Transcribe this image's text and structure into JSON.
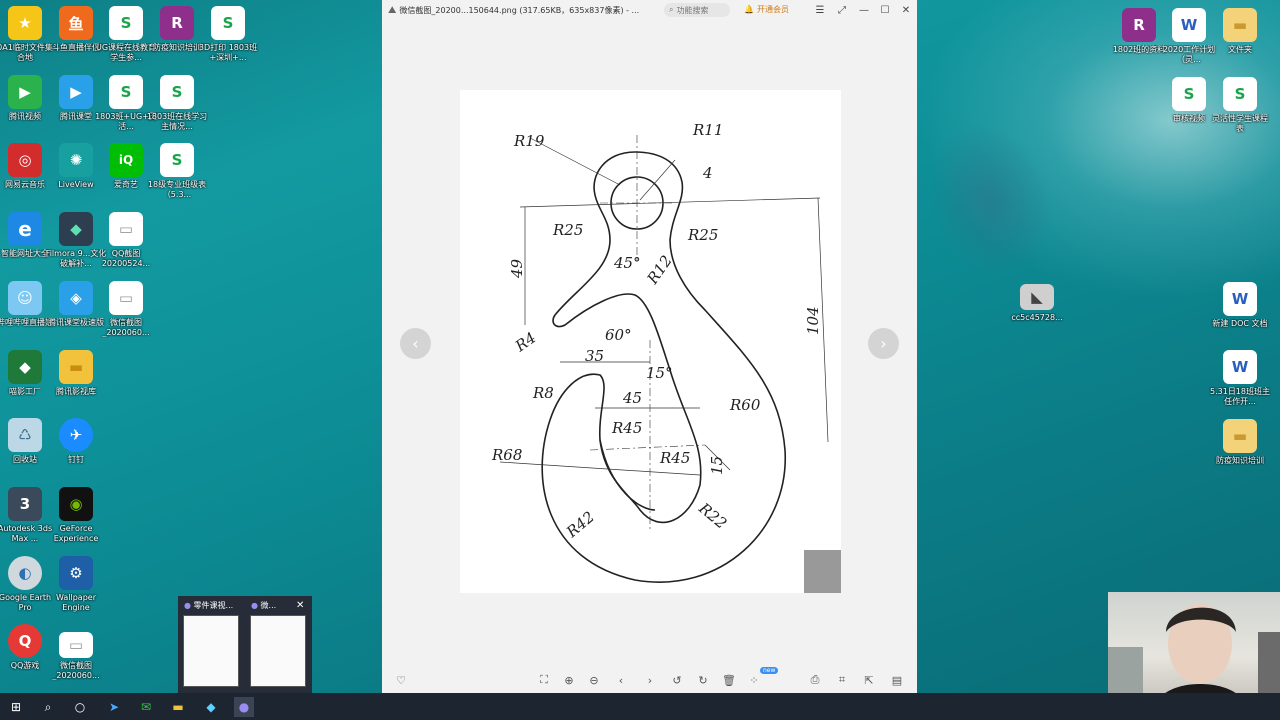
{
  "desktop_left": [
    {
      "label": "0A1临时文件集合地",
      "icon": "star-folder-icon",
      "color": "#f5c518",
      "glyph": "★"
    },
    {
      "label": "斗鱼直播伴侣",
      "icon": "douyu-icon",
      "color": "#f06a1d",
      "glyph": "鱼"
    },
    {
      "label": "UG课程在线教育学生参...",
      "icon": "sheet-doc-icon",
      "color": "#ffffff",
      "glyph": "S"
    },
    {
      "label": "防疫知识培训",
      "icon": "winrar-icon",
      "color": "#8e2f8c",
      "glyph": "R"
    },
    {
      "label": "3D打印 1803班+深圳+...",
      "icon": "sheet-doc-icon",
      "color": "#ffffff",
      "glyph": "S"
    },
    {
      "label": "腾讯视频",
      "icon": "tencent-video-icon",
      "color": "#2bb24c",
      "glyph": "▶"
    },
    {
      "label": "腾讯课堂",
      "icon": "tencent-class-icon",
      "color": "#2aa0e8",
      "glyph": "▶"
    },
    {
      "label": "1803班+UG+灵活...",
      "icon": "sheet-doc-icon",
      "color": "#ffffff",
      "glyph": "S"
    },
    {
      "label": "1803班在线学习主情况...",
      "icon": "sheet-doc-icon",
      "color": "#ffffff",
      "glyph": "S"
    },
    {
      "label": "网易云音乐",
      "icon": "netease-music-icon",
      "color": "#d22c2c",
      "glyph": "◎"
    },
    {
      "label": "LiveView",
      "icon": "liveview-icon",
      "color": "#18a0a0",
      "glyph": "✺"
    },
    {
      "label": "爱奇艺",
      "icon": "iqiyi-icon",
      "color": "#00be06",
      "glyph": "iQ"
    },
    {
      "label": "18级专业班级表（5.3...",
      "icon": "sheet-doc-icon",
      "color": "#ffffff",
      "glyph": "S"
    },
    {
      "label": "智能网址大全",
      "icon": "ie-browser-icon",
      "color": "#1e88e5",
      "glyph": "e"
    },
    {
      "label": "Filmora 9...文化破解补...",
      "icon": "filmora-icon",
      "color": "#2c3e50",
      "glyph": "◆"
    },
    {
      "label": "QQ截图20200524...",
      "icon": "image-file-icon",
      "color": "#ffffff",
      "glyph": "▭"
    },
    {
      "label": "哔哩哔哩直播姬",
      "icon": "bilibili-live-icon",
      "color": "#7cc8f2",
      "glyph": "☺"
    },
    {
      "label": "腾讯课堂极速版",
      "icon": "tencent-class-lite-icon",
      "color": "#2aa0e8",
      "glyph": "◈"
    },
    {
      "label": "微信截图_2020060...",
      "icon": "image-file-icon",
      "color": "#ffffff",
      "glyph": "▭"
    },
    {
      "label": "喵影工厂",
      "icon": "miaoying-icon",
      "color": "#1f7a3a",
      "glyph": "◆"
    },
    {
      "label": "腾讯影视库",
      "icon": "folder-icon",
      "color": "#f3c23c",
      "glyph": "▬"
    },
    {
      "label": "回收站",
      "icon": "recycle-bin-icon",
      "color": "#bcd7e6",
      "glyph": "♺"
    },
    {
      "label": "钉钉",
      "icon": "dingtalk-icon",
      "color": "#1a8cff",
      "glyph": "✈"
    },
    {
      "label": "Autodesk 3ds Max ...",
      "icon": "3dsmax-icon",
      "color": "#3a4a5a",
      "glyph": "3"
    },
    {
      "label": "GeForce Experience",
      "icon": "geforce-icon",
      "color": "#111111",
      "glyph": "◉"
    },
    {
      "label": "Google Earth Pro",
      "icon": "google-earth-icon",
      "color": "#cfd8dc",
      "glyph": "◐"
    },
    {
      "label": "Wallpaper Engine",
      "icon": "wallpaper-engine-icon",
      "color": "#1e5fa8",
      "glyph": "⚙"
    },
    {
      "label": "QQ游戏",
      "icon": "qq-game-icon",
      "color": "#e53935",
      "glyph": "Q"
    },
    {
      "label": "微信截图_2020060...",
      "icon": "image-file-icon",
      "color": "#ffffff",
      "glyph": "▭"
    }
  ],
  "desktop_right": [
    {
      "label": "1802班的资料",
      "icon": "winrar-icon",
      "color": "#8e2f8c",
      "glyph": "R"
    },
    {
      "label": "2020工作计划（灵...",
      "icon": "word-doc-icon",
      "color": "#2b5fbf",
      "glyph": "W"
    },
    {
      "label": "文件夹",
      "icon": "zip-folder-icon",
      "color": "#f3d27a",
      "glyph": "▬"
    },
    {
      "label": "审核视频",
      "icon": "sheet-doc-icon",
      "color": "#ffffff",
      "glyph": "S"
    },
    {
      "label": "灵活性学生课程表",
      "icon": "sheet-doc-icon",
      "color": "#ffffff",
      "glyph": "S"
    },
    {
      "label": "cc5c45728...",
      "icon": "image-file-icon",
      "color": "#cfcfcf",
      "glyph": "◣"
    },
    {
      "label": "新建 DOC 文档",
      "icon": "word-doc-icon",
      "color": "#2b5fbf",
      "glyph": "W"
    },
    {
      "label": "5.31日18班班主任作开...",
      "icon": "word-doc-icon",
      "color": "#2b5fbf",
      "glyph": "W"
    },
    {
      "label": "防疫知识培训",
      "icon": "zip-folder-icon",
      "color": "#f3d27a",
      "glyph": "▬"
    }
  ],
  "viewer": {
    "title": "微信截图_20200...150644.png (317.65KB，635x837像素) - ...",
    "search_placeholder": "功能搜索",
    "vip_label": "开通会员",
    "new_badge": "new",
    "prev_label": "‹",
    "next_label": "›"
  },
  "drawing": {
    "labels": [
      "R19",
      "R11",
      "4",
      "R25",
      "R25",
      "49",
      "45°",
      "R12",
      "104",
      "R4",
      "60°",
      "35",
      "15°",
      "R8",
      "45",
      "R60",
      "R45",
      "R68",
      "R45",
      "15",
      "R22",
      "R42"
    ]
  },
  "thumbnails": [
    {
      "title": "零件课视..."
    },
    {
      "title": "微..."
    }
  ]
}
